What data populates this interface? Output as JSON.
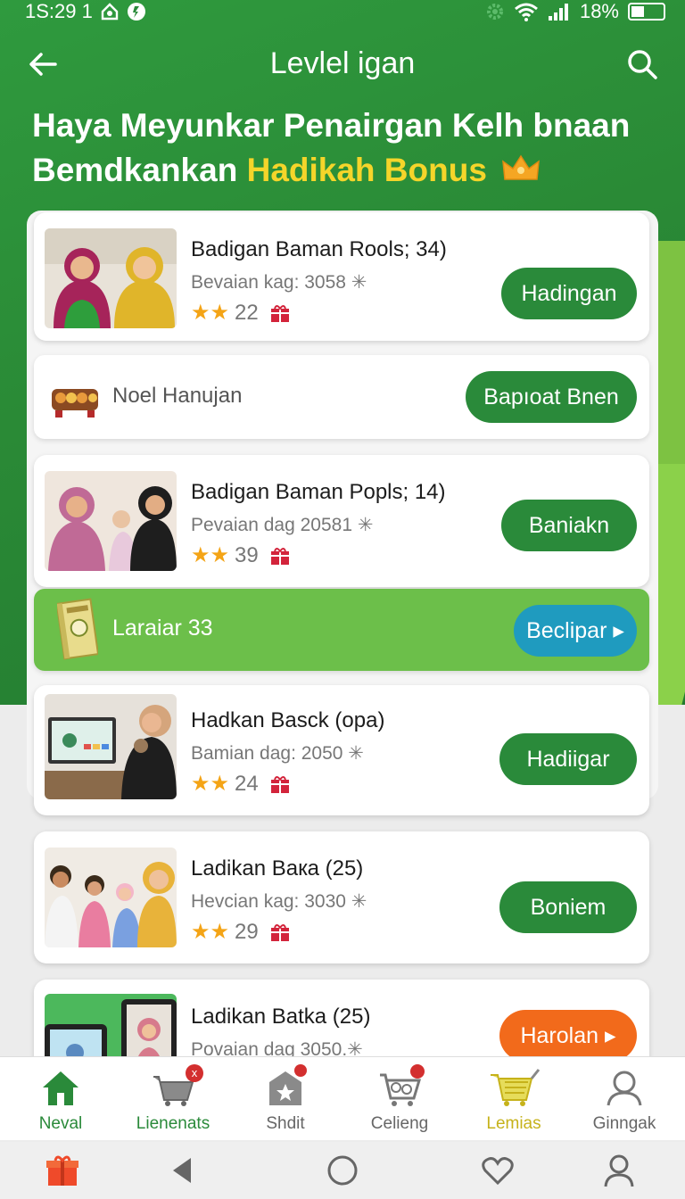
{
  "status": {
    "time": "1S:29 1",
    "battery": "18%"
  },
  "appbar": {
    "title": "Levlel igan"
  },
  "headline": {
    "line1": "Haya Meyunkar Penairgan Kelh bnaan",
    "line2_start": "Bemdkankan",
    "line2_accent": "Hadikah Bonus"
  },
  "items": [
    {
      "name": "Badigan Baman Rools; 34)",
      "sub": "Bevaian kag: 3058 ✳",
      "rating": "22",
      "button": "Hadingan"
    },
    {
      "name": "Badigan Baman Popls; 14)",
      "sub": "Pevaian dag 20581 ✳",
      "rating": "39",
      "button": "Baniakn"
    },
    {
      "name": "Hadkan Basck (opa)",
      "sub": "Bamian dag: 2050 ✳",
      "rating": "24",
      "button": "Hadiigar"
    },
    {
      "name": "Ladikan Baкa (25)",
      "sub": "Hevcian kag: 3030 ✳",
      "rating": "29",
      "button": "Boniem"
    },
    {
      "name": "Ladikan Batka (25)",
      "sub": "Povaian dag 3050.✳",
      "rating": "",
      "button": "Harolan ▸"
    }
  ],
  "banner1": {
    "label": "Noel Hanujan",
    "button": "Bapıoat Bnen"
  },
  "banner2": {
    "label": "Laraiar 33",
    "button": "Beclipar ▸"
  },
  "nav": [
    {
      "label": "Neval"
    },
    {
      "label": "Lienenats"
    },
    {
      "label": "Shdit"
    },
    {
      "label": "Celieng"
    },
    {
      "label": "Lemias"
    },
    {
      "label": "Ginngak"
    }
  ],
  "colors": {
    "primary": "#2a8a3a",
    "accent": "#f5d52a",
    "teal": "#1f9bbf",
    "orange": "#f26a1b"
  }
}
